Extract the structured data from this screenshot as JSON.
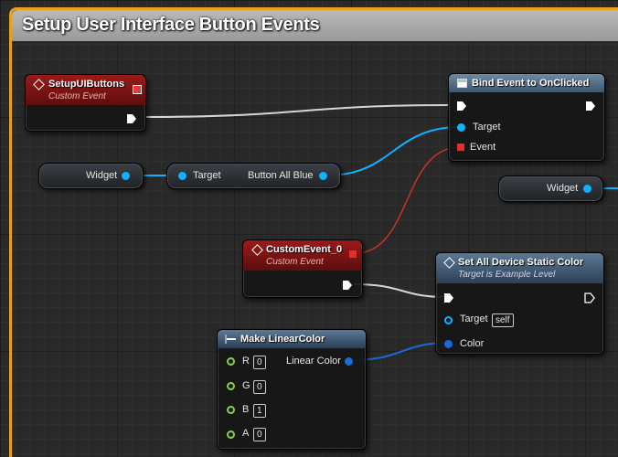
{
  "comment": {
    "title": "Setup User Interface Button Events",
    "border_color": "#e6a21a"
  },
  "nodes": {
    "setup_ui_buttons": {
      "title": "SetupUIButtons",
      "subtitle": "Custom Event"
    },
    "bind_event": {
      "title": "Bind Event to OnClicked",
      "pin_target": "Target",
      "pin_event": "Event"
    },
    "widget_var_1": {
      "label": "Widget"
    },
    "widget_var_2": {
      "label": "Widget"
    },
    "button_getter": {
      "pin_target": "Target",
      "output": "Button All Blue"
    },
    "custom_event_0": {
      "title": "CustomEvent_0",
      "subtitle": "Custom Event"
    },
    "set_all_device": {
      "title": "Set All Device Static Color",
      "subtitle": "Target is Example Level",
      "pin_target": "Target",
      "pin_target_value": "self",
      "pin_color": "Color"
    },
    "make_linear_color": {
      "title": "Make LinearColor",
      "output": "Linear Color",
      "inputs": [
        {
          "name": "R",
          "value": "0"
        },
        {
          "name": "G",
          "value": "0"
        },
        {
          "name": "B",
          "value": "1"
        },
        {
          "name": "A",
          "value": "0"
        }
      ]
    }
  },
  "colors": {
    "exec_wire": "#d6d6d6",
    "object_pin": "#0fb2ff",
    "delegate_pin": "#e0302b",
    "struct_pin": "#1a6bd6",
    "float_pin": "#88d24a",
    "event_header": "#9b1a1a",
    "function_header": "#5c7996"
  }
}
